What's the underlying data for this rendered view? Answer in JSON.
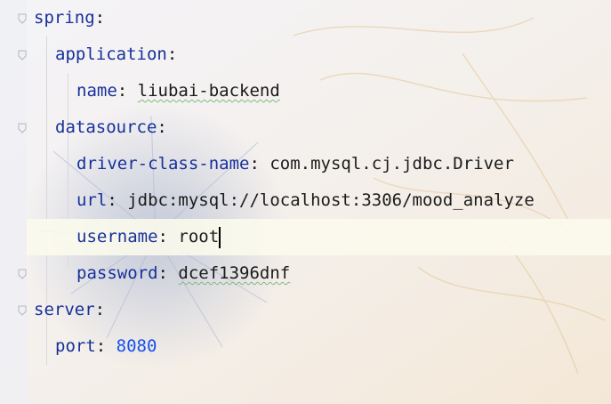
{
  "editor": {
    "lines": [
      {
        "key": "spring",
        "sep": ":",
        "value": ""
      },
      {
        "key": "application",
        "sep": ":",
        "value": ""
      },
      {
        "key": "name",
        "sep": ": ",
        "value": "liubai-backend"
      },
      {
        "key": "datasource",
        "sep": ":",
        "value": ""
      },
      {
        "key": "driver-class-name",
        "sep": ": ",
        "value": "com.mysql.cj.jdbc.Driver"
      },
      {
        "key": "url",
        "sep": ": ",
        "value": "jdbc:mysql://localhost:3306/mood_analyze"
      },
      {
        "key": "username",
        "sep": ": ",
        "value": "root"
      },
      {
        "key": "password",
        "sep": ": ",
        "value": "dcef1396dnf"
      },
      {
        "key": "server",
        "sep": ":",
        "value": ""
      },
      {
        "key": "port",
        "sep": ": ",
        "value": "8080"
      }
    ],
    "current_line": 6
  },
  "colors": {
    "key": "#17309a",
    "number": "#1750eb",
    "text": "#1b1b1b",
    "current_line_bg": "#fcfaed"
  },
  "icons": [
    "fold-marker-icon",
    "text-caret"
  ]
}
